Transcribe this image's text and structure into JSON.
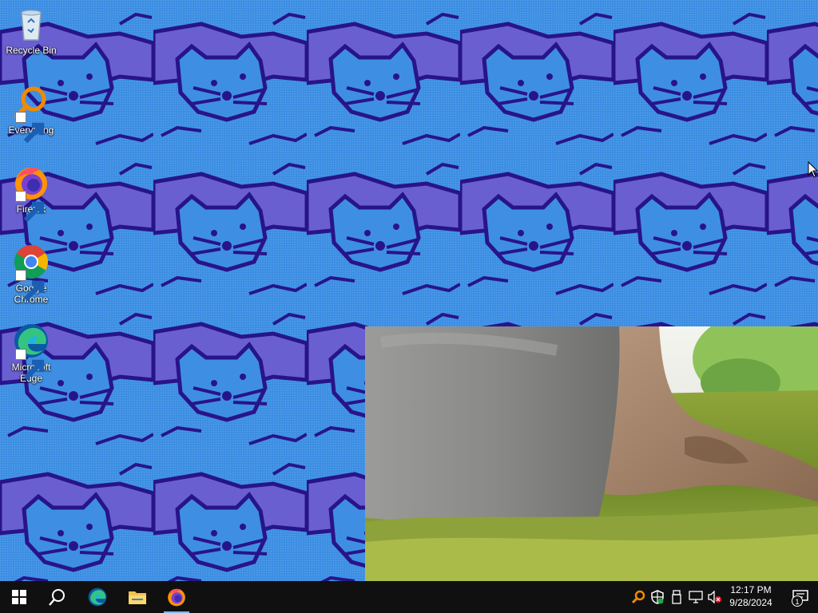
{
  "desktop": {
    "icons": [
      {
        "label": "Recycle Bin",
        "icon": "recycle-bin-icon"
      },
      {
        "label": "Everything",
        "icon": "everything-search-icon"
      },
      {
        "label": "Firefox",
        "icon": "firefox-icon"
      },
      {
        "label": "Google Chrome",
        "icon": "chrome-icon"
      },
      {
        "label": "Microsoft Edge",
        "icon": "edge-icon"
      }
    ]
  },
  "taskbar": {
    "pinned": [
      {
        "icon": "windows-start-icon"
      },
      {
        "icon": "search-icon"
      },
      {
        "icon": "edge-icon"
      },
      {
        "icon": "file-explorer-icon"
      },
      {
        "icon": "firefox-icon"
      }
    ],
    "tray": [
      {
        "icon": "everything-tray-icon"
      },
      {
        "icon": "windows-security-icon"
      },
      {
        "icon": "usb-drive-icon"
      },
      {
        "icon": "network-icon"
      },
      {
        "icon": "volume-muted-icon"
      }
    ],
    "clock": {
      "time": "12:17 PM",
      "date": "9/28/2024"
    },
    "notification_count": "1"
  },
  "colors": {
    "wallpaper_blue": "#3e8fe3",
    "wallpaper_cat": "#6a5fd0",
    "wallpaper_outline": "#28148a",
    "taskbar": "#101010",
    "active_indicator": "#76b9ed"
  }
}
